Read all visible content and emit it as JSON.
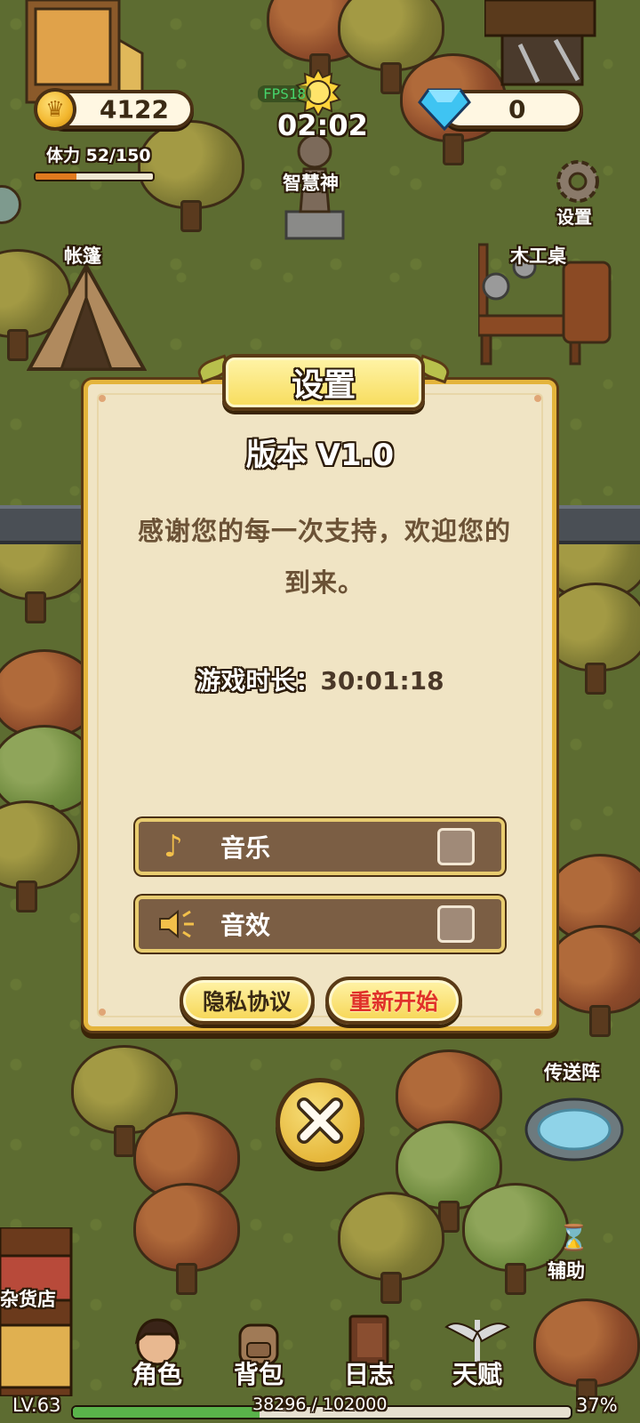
{
  "hud": {
    "gold": "4122",
    "gems": "0",
    "stamina_label": "体力 52/150",
    "stamina_ratio": 0.347,
    "timer": "02:02",
    "fps_label": "FPS18"
  },
  "map_labels": {
    "statue": "智慧神",
    "settings": "设置",
    "tent": "帐篷",
    "workbench": "木工桌",
    "portal": "传送阵",
    "assist": "辅助",
    "shop": "杂货店"
  },
  "dialog": {
    "title": "设置",
    "version": "版本 V1.0",
    "message": "感谢您的每一次支持，欢迎您的到来。",
    "playtime_label": "游戏时长：",
    "playtime_value": "30:01:18",
    "music_label": "音乐",
    "sfx_label": "音效",
    "music_on": false,
    "sfx_on": false,
    "privacy_button": "隐私协议",
    "restart_button": "重新开始",
    "restart_color": "#e0322a"
  },
  "bottom_nav": [
    {
      "label": "角色",
      "icon": "character-icon"
    },
    {
      "label": "背包",
      "icon": "backpack-icon"
    },
    {
      "label": "日志",
      "icon": "journal-icon"
    },
    {
      "label": "天赋",
      "icon": "talent-icon"
    }
  ],
  "xp": {
    "level": "LV.63",
    "progress_text": "38296 / 102000",
    "percent": "37%",
    "ratio": 0.375
  },
  "colors": {
    "accent_gold": "#f6d655",
    "panel": "#f0e4c4",
    "row_bg": "#7b5e44",
    "xp_green": "#59b34a",
    "stamina_orange": "#e07a1e"
  }
}
